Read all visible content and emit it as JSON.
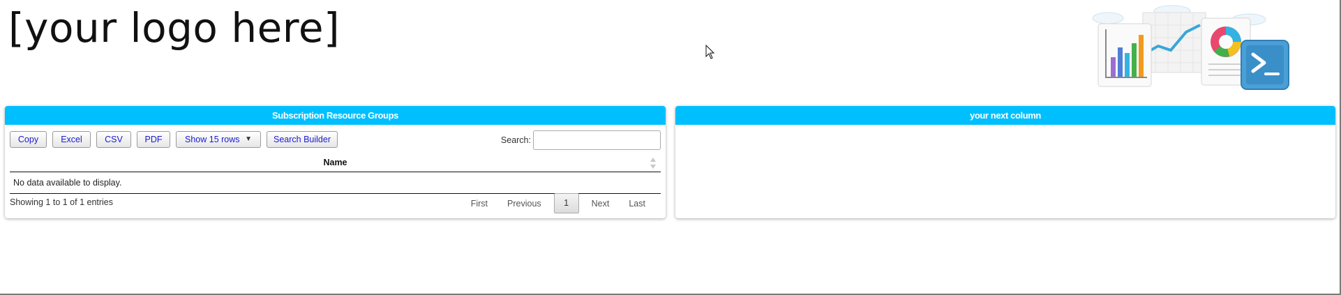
{
  "header": {
    "logo_text": "[your logo here]"
  },
  "left_panel": {
    "title": "Subscription Resource Groups",
    "toolbar": {
      "copy_label": "Copy",
      "excel_label": "Excel",
      "csv_label": "CSV",
      "pdf_label": "PDF",
      "rows_label": "Show 15 rows",
      "rows_caret": "▼",
      "search_builder_label": "Search Builder"
    },
    "search": {
      "label": "Search:",
      "value": "",
      "placeholder": ""
    },
    "table": {
      "columns": [
        "Name"
      ],
      "empty_message": "No data available to display."
    },
    "info_text": "Showing 1 to 1 of 1 entries",
    "pagination": {
      "first": "First",
      "previous": "Previous",
      "current": "1",
      "next": "Next",
      "last": "Last"
    }
  },
  "right_panel": {
    "title": "your next column"
  },
  "colors": {
    "panel_header": "#00bfff",
    "button_text": "#1a1ad0"
  },
  "icons": [
    "bar-chart-icon",
    "line-chart-icon",
    "pie-chart-icon",
    "powershell-icon",
    "mouse-cursor-icon",
    "sort-icon"
  ]
}
